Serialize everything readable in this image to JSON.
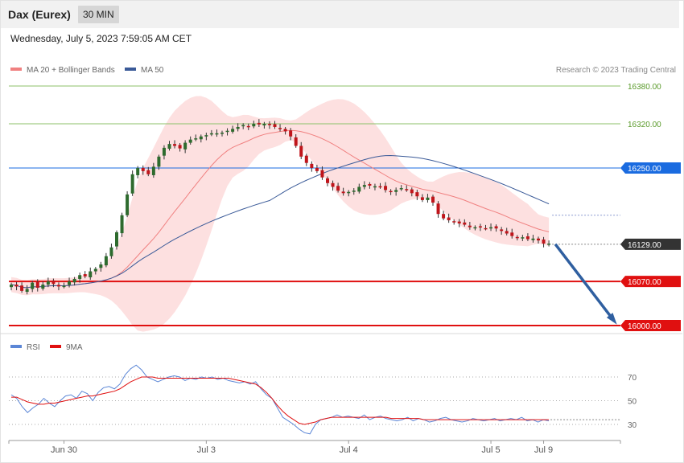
{
  "header": {
    "title": "Dax (Eurex)",
    "interval": "30 MIN",
    "datetime": "Wednesday, July 5, 2023 7:59:05 AM CET"
  },
  "legend": {
    "ma20": "MA 20 + Bollinger Bands",
    "ma50": "MA 50",
    "credit": "Research © 2023 Trading Central"
  },
  "colors": {
    "ma20": "#f08080",
    "bb_fill": "#fde0e0",
    "ma50": "#3a5a98",
    "candle_up": "#2e6b2e",
    "candle_down": "#c0151b",
    "resistance": "#8cc26a",
    "pivot": "#1a6be0",
    "support": "#e01010",
    "current": "#333333",
    "arrow": "#2f5fa0",
    "rsi": "#5b86d6",
    "rsi_ma": "#e01010"
  },
  "price_levels": [
    {
      "value": 16380,
      "label": "16380.00",
      "kind": "resistance"
    },
    {
      "value": 16320,
      "label": "16320.00",
      "kind": "resistance"
    },
    {
      "value": 16250,
      "label": "16250.00",
      "kind": "pivot"
    },
    {
      "value": 16129,
      "label": "16129.00",
      "kind": "current"
    },
    {
      "value": 16070,
      "label": "16070.00",
      "kind": "support"
    },
    {
      "value": 16000,
      "label": "16000.00",
      "kind": "support"
    }
  ],
  "rsi_panel": {
    "legend": {
      "rsi": "RSI",
      "ma": "9MA"
    },
    "levels": [
      {
        "value": 70,
        "label": "70"
      },
      {
        "value": 50,
        "label": "50"
      },
      {
        "value": 30,
        "label": "30"
      }
    ]
  },
  "x_labels": [
    {
      "label": "Jun 30",
      "index": 10
    },
    {
      "label": "Jul 3",
      "index": 37
    },
    {
      "label": "Jul 4",
      "index": 64
    },
    {
      "label": "Jul 5",
      "index": 91
    },
    {
      "label": "Jul 9",
      "index": 101
    }
  ],
  "chart_data": {
    "type": "candlestick",
    "title": "Dax (Eurex)",
    "timeframe": "30 MIN",
    "ylim": [
      15995,
      16400
    ],
    "y_ticks": [
      16380,
      16320,
      16250,
      16129,
      16070,
      16000
    ],
    "closes": [
      16065,
      16062,
      16055,
      16058,
      16068,
      16060,
      16065,
      16070,
      16066,
      16062,
      16063,
      16070,
      16074,
      16080,
      16078,
      16086,
      16090,
      16097,
      16110,
      16124,
      16148,
      16175,
      16208,
      16240,
      16250,
      16245,
      16240,
      16252,
      16268,
      16282,
      16288,
      16285,
      16281,
      16290,
      16295,
      16297,
      16300,
      16302,
      16305,
      16305,
      16306,
      16309,
      16312,
      16315,
      16318,
      16316,
      16320,
      16319,
      16320,
      16318,
      16315,
      16312,
      16308,
      16300,
      16285,
      16268,
      16258,
      16250,
      16245,
      16235,
      16226,
      16220,
      16214,
      16210,
      16212,
      16214,
      16220,
      16223,
      16222,
      16221,
      16220,
      16215,
      16212,
      16215,
      16218,
      16216,
      16210,
      16205,
      16199,
      16203,
      16195,
      16177,
      16170,
      16167,
      16165,
      16162,
      16160,
      16156,
      16156,
      16156,
      16154,
      16156,
      16154,
      16150,
      16146,
      16142,
      16140,
      16140,
      16137,
      16138,
      16135,
      16130,
      16130
    ],
    "ohlc_note": "closes are approximate 30-minute closes; candles derived as open = previous close",
    "ma20_last": 16150,
    "ma50_last": 16175,
    "projection": {
      "from": 16129,
      "to": 16000
    },
    "rsi": {
      "name": "RSI",
      "ma_name": "9MA",
      "ylim": [
        20,
        82
      ],
      "rsi_values": [
        55,
        52,
        45,
        40,
        44,
        47,
        52,
        48,
        45,
        50,
        54,
        55,
        52,
        58,
        56,
        50,
        57,
        61,
        62,
        60,
        64,
        72,
        77,
        80,
        76,
        70,
        68,
        66,
        68,
        70,
        71,
        70,
        67,
        69,
        68,
        70,
        69,
        70,
        68,
        69,
        67,
        66,
        65,
        66,
        64,
        66,
        60,
        55,
        52,
        44,
        36,
        33,
        30,
        26,
        23,
        22,
        30,
        34,
        35,
        36,
        38,
        36,
        37,
        36,
        35,
        38,
        34,
        36,
        37,
        35,
        34,
        33,
        34,
        36,
        33,
        35,
        34,
        32,
        33,
        35,
        36,
        34,
        33,
        32,
        33,
        35,
        34,
        33,
        34,
        35,
        33,
        34,
        35,
        34,
        36,
        33,
        34,
        32,
        34,
        33
      ],
      "ma_values": [
        53,
        53,
        51,
        49,
        48,
        47,
        47,
        48,
        48,
        49,
        50,
        51,
        52,
        53,
        54,
        54,
        55,
        56,
        57,
        58,
        60,
        63,
        66,
        68,
        70,
        70,
        70,
        69,
        69,
        69,
        69,
        69,
        69,
        69,
        69,
        69,
        69,
        69,
        69,
        69,
        69,
        68,
        67,
        66,
        65,
        64,
        61,
        57,
        52,
        46,
        41,
        37,
        34,
        31,
        30,
        31,
        32,
        34,
        35,
        36,
        36,
        36,
        36,
        36,
        36,
        36,
        36,
        36,
        36,
        36,
        35,
        35,
        35,
        35,
        35,
        35,
        34,
        34,
        34,
        34,
        34,
        34,
        34,
        34,
        34,
        34,
        34,
        34,
        34,
        34,
        34,
        34,
        34,
        34,
        34,
        34,
        34,
        34,
        34,
        34
      ]
    }
  }
}
